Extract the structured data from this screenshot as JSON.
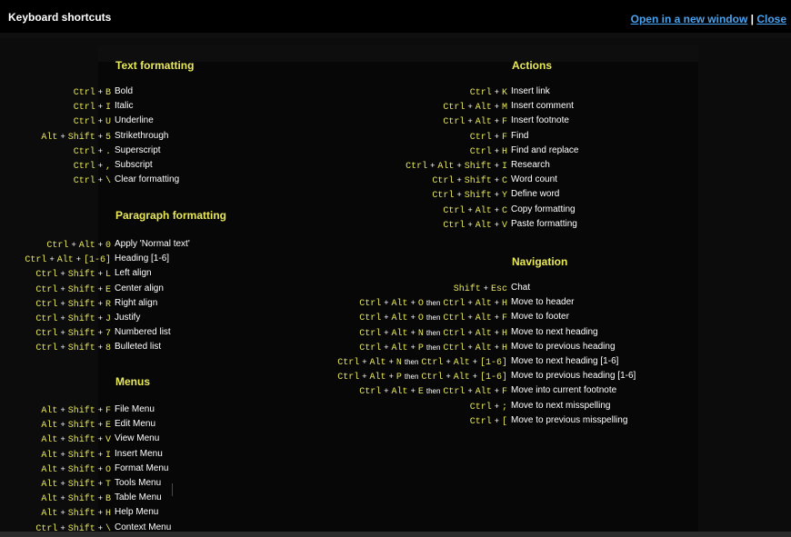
{
  "header": {
    "title": "Keyboard shortcuts",
    "open_link": "Open in a new window",
    "separator": " | ",
    "close_link": "Close"
  },
  "columns": [
    {
      "x": 0,
      "sections": [
        {
          "title": "Text formatting",
          "items": [
            {
              "keys": [
                [
                  "Ctrl",
                  "B"
                ]
              ],
              "desc": "Bold"
            },
            {
              "keys": [
                [
                  "Ctrl",
                  "I"
                ]
              ],
              "desc": "Italic"
            },
            {
              "keys": [
                [
                  "Ctrl",
                  "U"
                ]
              ],
              "desc": "Underline"
            },
            {
              "keys": [
                [
                  "Alt",
                  "Shift",
                  "5"
                ]
              ],
              "desc": "Strikethrough"
            },
            {
              "keys": [
                [
                  "Ctrl",
                  "."
                ]
              ],
              "desc": "Superscript"
            },
            {
              "keys": [
                [
                  "Ctrl",
                  ","
                ]
              ],
              "desc": "Subscript"
            },
            {
              "keys": [
                [
                  "Ctrl",
                  "\\"
                ]
              ],
              "desc": "Clear formatting"
            }
          ]
        },
        {
          "title": "Paragraph formatting",
          "items": [
            {
              "keys": [
                [
                  "Ctrl",
                  "Alt",
                  "0"
                ]
              ],
              "desc": "Apply 'Normal text'"
            },
            {
              "keys": [
                [
                  "Ctrl",
                  "Alt",
                  "[1-6]"
                ]
              ],
              "desc": "Heading [1-6]"
            },
            {
              "keys": [
                [
                  "Ctrl",
                  "Shift",
                  "L"
                ]
              ],
              "desc": "Left align"
            },
            {
              "keys": [
                [
                  "Ctrl",
                  "Shift",
                  "E"
                ]
              ],
              "desc": "Center align"
            },
            {
              "keys": [
                [
                  "Ctrl",
                  "Shift",
                  "R"
                ]
              ],
              "desc": "Right align"
            },
            {
              "keys": [
                [
                  "Ctrl",
                  "Shift",
                  "J"
                ]
              ],
              "desc": "Justify"
            },
            {
              "keys": [
                [
                  "Ctrl",
                  "Shift",
                  "7"
                ]
              ],
              "desc": "Numbered list"
            },
            {
              "keys": [
                [
                  "Ctrl",
                  "Shift",
                  "8"
                ]
              ],
              "desc": "Bulleted list"
            }
          ]
        },
        {
          "title": "Menus",
          "items": [
            {
              "keys": [
                [
                  "Alt",
                  "Shift",
                  "F"
                ]
              ],
              "desc": "File Menu"
            },
            {
              "keys": [
                [
                  "Alt",
                  "Shift",
                  "E"
                ]
              ],
              "desc": "Edit Menu"
            },
            {
              "keys": [
                [
                  "Alt",
                  "Shift",
                  "V"
                ]
              ],
              "desc": "View Menu"
            },
            {
              "keys": [
                [
                  "Alt",
                  "Shift",
                  "I"
                ]
              ],
              "desc": "Insert Menu"
            },
            {
              "keys": [
                [
                  "Alt",
                  "Shift",
                  "O"
                ]
              ],
              "desc": "Format Menu"
            },
            {
              "keys": [
                [
                  "Alt",
                  "Shift",
                  "T"
                ]
              ],
              "desc": "Tools Menu"
            },
            {
              "keys": [
                [
                  "Alt",
                  "Shift",
                  "B"
                ]
              ],
              "desc": "Table Menu"
            },
            {
              "keys": [
                [
                  "Alt",
                  "Shift",
                  "H"
                ]
              ],
              "desc": "Help Menu"
            },
            {
              "keys": [
                [
                  "Ctrl",
                  "Shift",
                  "\\"
                ]
              ],
              "desc": "Context Menu"
            }
          ]
        }
      ]
    },
    {
      "sections": [
        {
          "title": "Actions",
          "items": [
            {
              "keys": [
                [
                  "Ctrl",
                  "K"
                ]
              ],
              "desc": "Insert link"
            },
            {
              "keys": [
                [
                  "Ctrl",
                  "Alt",
                  "M"
                ]
              ],
              "desc": "Insert comment"
            },
            {
              "keys": [
                [
                  "Ctrl",
                  "Alt",
                  "F"
                ]
              ],
              "desc": "Insert footnote"
            },
            {
              "keys": [
                [
                  "Ctrl",
                  "F"
                ]
              ],
              "desc": "Find"
            },
            {
              "keys": [
                [
                  "Ctrl",
                  "H"
                ]
              ],
              "desc": "Find and replace"
            },
            {
              "keys": [
                [
                  "Ctrl",
                  "Alt",
                  "Shift",
                  "I"
                ]
              ],
              "desc": "Research"
            },
            {
              "keys": [
                [
                  "Ctrl",
                  "Shift",
                  "C"
                ]
              ],
              "desc": "Word count"
            },
            {
              "keys": [
                [
                  "Ctrl",
                  "Shift",
                  "Y"
                ]
              ],
              "desc": "Define word"
            },
            {
              "keys": [
                [
                  "Ctrl",
                  "Alt",
                  "C"
                ]
              ],
              "desc": "Copy formatting"
            },
            {
              "keys": [
                [
                  "Ctrl",
                  "Alt",
                  "V"
                ]
              ],
              "desc": "Paste formatting"
            }
          ]
        },
        {
          "title": "Navigation",
          "items": [
            {
              "keys": [
                [
                  "Shift",
                  "Esc"
                ]
              ],
              "desc": "Chat"
            },
            {
              "keys": [
                [
                  "Ctrl",
                  "Alt",
                  "O"
                ],
                [
                  "Ctrl",
                  "Alt",
                  "H"
                ]
              ],
              "desc": "Move to header"
            },
            {
              "keys": [
                [
                  "Ctrl",
                  "Alt",
                  "O"
                ],
                [
                  "Ctrl",
                  "Alt",
                  "F"
                ]
              ],
              "desc": "Move to footer"
            },
            {
              "keys": [
                [
                  "Ctrl",
                  "Alt",
                  "N"
                ],
                [
                  "Ctrl",
                  "Alt",
                  "H"
                ]
              ],
              "desc": "Move to next heading"
            },
            {
              "keys": [
                [
                  "Ctrl",
                  "Alt",
                  "P"
                ],
                [
                  "Ctrl",
                  "Alt",
                  "H"
                ]
              ],
              "desc": "Move to previous heading"
            },
            {
              "keys": [
                [
                  "Ctrl",
                  "Alt",
                  "N"
                ],
                [
                  "Ctrl",
                  "Alt",
                  "[1-6]"
                ]
              ],
              "desc": "Move to next heading [1-6]"
            },
            {
              "keys": [
                [
                  "Ctrl",
                  "Alt",
                  "P"
                ],
                [
                  "Ctrl",
                  "Alt",
                  "[1-6]"
                ]
              ],
              "desc": "Move to previous heading [1-6]"
            },
            {
              "keys": [
                [
                  "Ctrl",
                  "Alt",
                  "E"
                ],
                [
                  "Ctrl",
                  "Alt",
                  "F"
                ]
              ],
              "desc": "Move into current footnote"
            },
            {
              "keys": [
                [
                  "Ctrl",
                  ";"
                ]
              ],
              "desc": "Move to next misspelling"
            },
            {
              "keys": [
                [
                  "Ctrl",
                  "["
                ]
              ],
              "desc": "Move to previous misspelling"
            }
          ]
        }
      ]
    }
  ],
  "then_word": "then",
  "colors": {
    "accent": "#e8e85a",
    "link": "#4aa3f0"
  }
}
